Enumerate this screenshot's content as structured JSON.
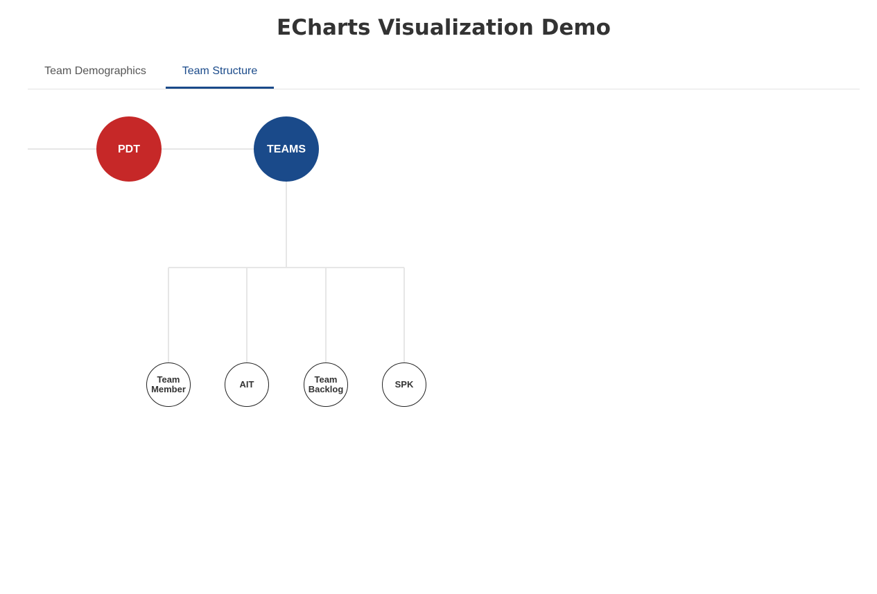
{
  "page": {
    "title": "ECharts Visualization Demo"
  },
  "tabs": [
    {
      "label": "Team Demographics",
      "active": false
    },
    {
      "label": "Team Structure",
      "active": true
    }
  ],
  "colors": {
    "accent": "#1a4a8a",
    "pdt_node": "#c62828",
    "teams_node": "#1a4a8a",
    "edge": "#e6e6e6"
  },
  "diagram": {
    "root": {
      "label": "PDT"
    },
    "hub": {
      "label": "TEAMS"
    },
    "children": [
      {
        "line1": "Team",
        "line2": "Member"
      },
      {
        "line1": "AIT",
        "line2": ""
      },
      {
        "line1": "Team",
        "line2": "Backlog"
      },
      {
        "line1": "SPK",
        "line2": ""
      }
    ]
  }
}
